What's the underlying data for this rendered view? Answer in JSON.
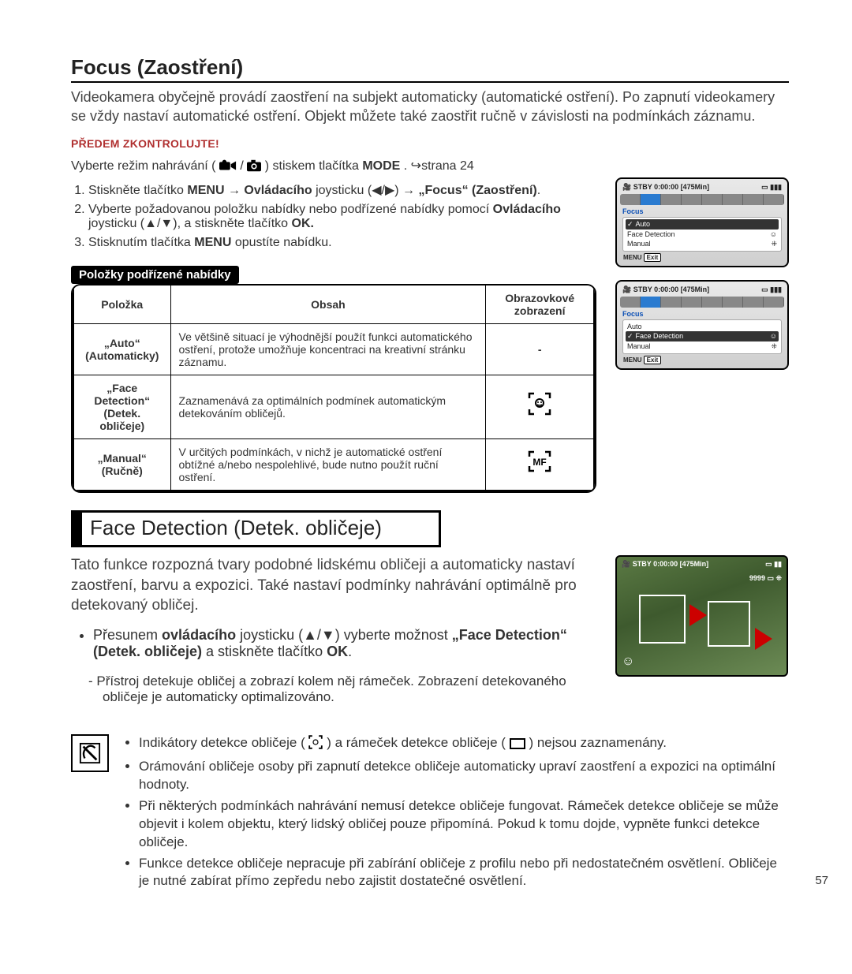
{
  "page_number": "57",
  "h1": "Focus (Zaostření)",
  "intro": "Videokamera obyčejně provádí zaostření na subjekt automaticky (automatické ostření). Po zapnutí videokamery se vždy nastaví automatické ostření. Objekt můžete také zaostřit ručně v závislosti na podmínkách záznamu.",
  "precheck": "PŘEDEM ZKONTROLUJTE!",
  "mode_line_pre": "Vyberte režim nahrávání ( ",
  "mode_line_mid": " / ",
  "mode_line_post": " ) stiskem tlačítka ",
  "mode_bold": "MODE",
  "mode_page": ". ↪strana 24",
  "steps": {
    "s1a": "Stiskněte tlačítko ",
    "s1b": "MENU",
    "s1c": " → ",
    "s1d": "Ovládacího",
    "s1e": " joysticku (◀/▶) → ",
    "s1f": "„Focus“ (Zaostření)",
    "s1g": ".",
    "s2a": "Vyberte požadovanou položku nabídky nebo podřízené nabídky pomocí ",
    "s2b": "Ovládacího",
    "s2c": " joysticku (▲/▼), a stiskněte tlačítko ",
    "s2d": "OK.",
    "s3a": "Stisknutím tlačítka ",
    "s3b": "MENU",
    "s3c": " opustíte nabídku."
  },
  "subhead": "Položky podřízené nabídky",
  "table": {
    "h1": "Položka",
    "h2": "Obsah",
    "h3": "Obrazovkové zobrazení",
    "r1c1a": "„Auto“",
    "r1c1b": "(Automaticky)",
    "r1c2": "Ve většině situací je výhodnější použít funkci automatického ostření, protože umožňuje koncentraci na kreativní stránku záznamu.",
    "r1c3": "-",
    "r2c1a": "„Face Detection“",
    "r2c1b": "(Detek. obličeje)",
    "r2c2": "Zaznamenává za optimálních podmínek automatickým detekováním obličejů.",
    "r3c1a": "„Manual“",
    "r3c1b": "(Ručně)",
    "r3c2": "V určitých podmínkách, v nichž je automatické ostření obtížné a/nebo nespolehlivé, bude nutno použít ruční ostření."
  },
  "cam": {
    "stby": "STBY",
    "time": "0:00:00",
    "remain": "[475Min]",
    "focus": "Focus",
    "auto": "Auto",
    "fd": "Face Detection",
    "manual": "Manual",
    "menu": "MENU",
    "exit": "Exit"
  },
  "h2": "Face Detection (Detek. obličeje)",
  "fd_intro": "Tato funkce rozpozná tvary podobné lidskému obličeji a automaticky nastaví zaostření, barvu a expozici. Také nastaví podmínky nahrávání optimálně pro detekovaný obličej.",
  "fd_bullet_a": "Přesunem ",
  "fd_bullet_b": "ovládacího",
  "fd_bullet_c": " joysticku (▲/▼) vyberte možnost ",
  "fd_bullet_d": "„Face Detection“ (Detek. obličeje)",
  "fd_bullet_e": " a stiskněte tlačítko ",
  "fd_bullet_f": "OK",
  "fd_bullet_g": ".",
  "fd_dash": "Přístroj detekuje obličej a zobrazí kolem něj rámeček. Zobrazení detekovaného obličeje je automaticky optimalizováno.",
  "photo": {
    "stby": "STBY",
    "time": "0:00:00 [475Min]",
    "count": "9999"
  },
  "notes": {
    "n1a": "Indikátory detekce obličeje (",
    "n1b": ") a rámeček detekce obličeje ( ",
    "n1c": " ) nejsou zaznamenány.",
    "n2": "Orámování obličeje osoby při zapnutí detekce obličeje automaticky upraví zaostření a expozici na optimální hodnoty.",
    "n3": "Při některých podmínkách nahrávání nemusí detekce obličeje fungovat. Rámeček detekce obličeje se může objevit i kolem objektu, který lidský obličej pouze připomíná. Pokud k tomu dojde, vypněte funkci detekce obličeje.",
    "n4": "Funkce detekce obličeje nepracuje při zabírání obličeje z profilu nebo při nedostatečném osvětlení. Obličeje je nutné zabírat přímo zepředu nebo zajistit dostatečné osvětlení."
  }
}
